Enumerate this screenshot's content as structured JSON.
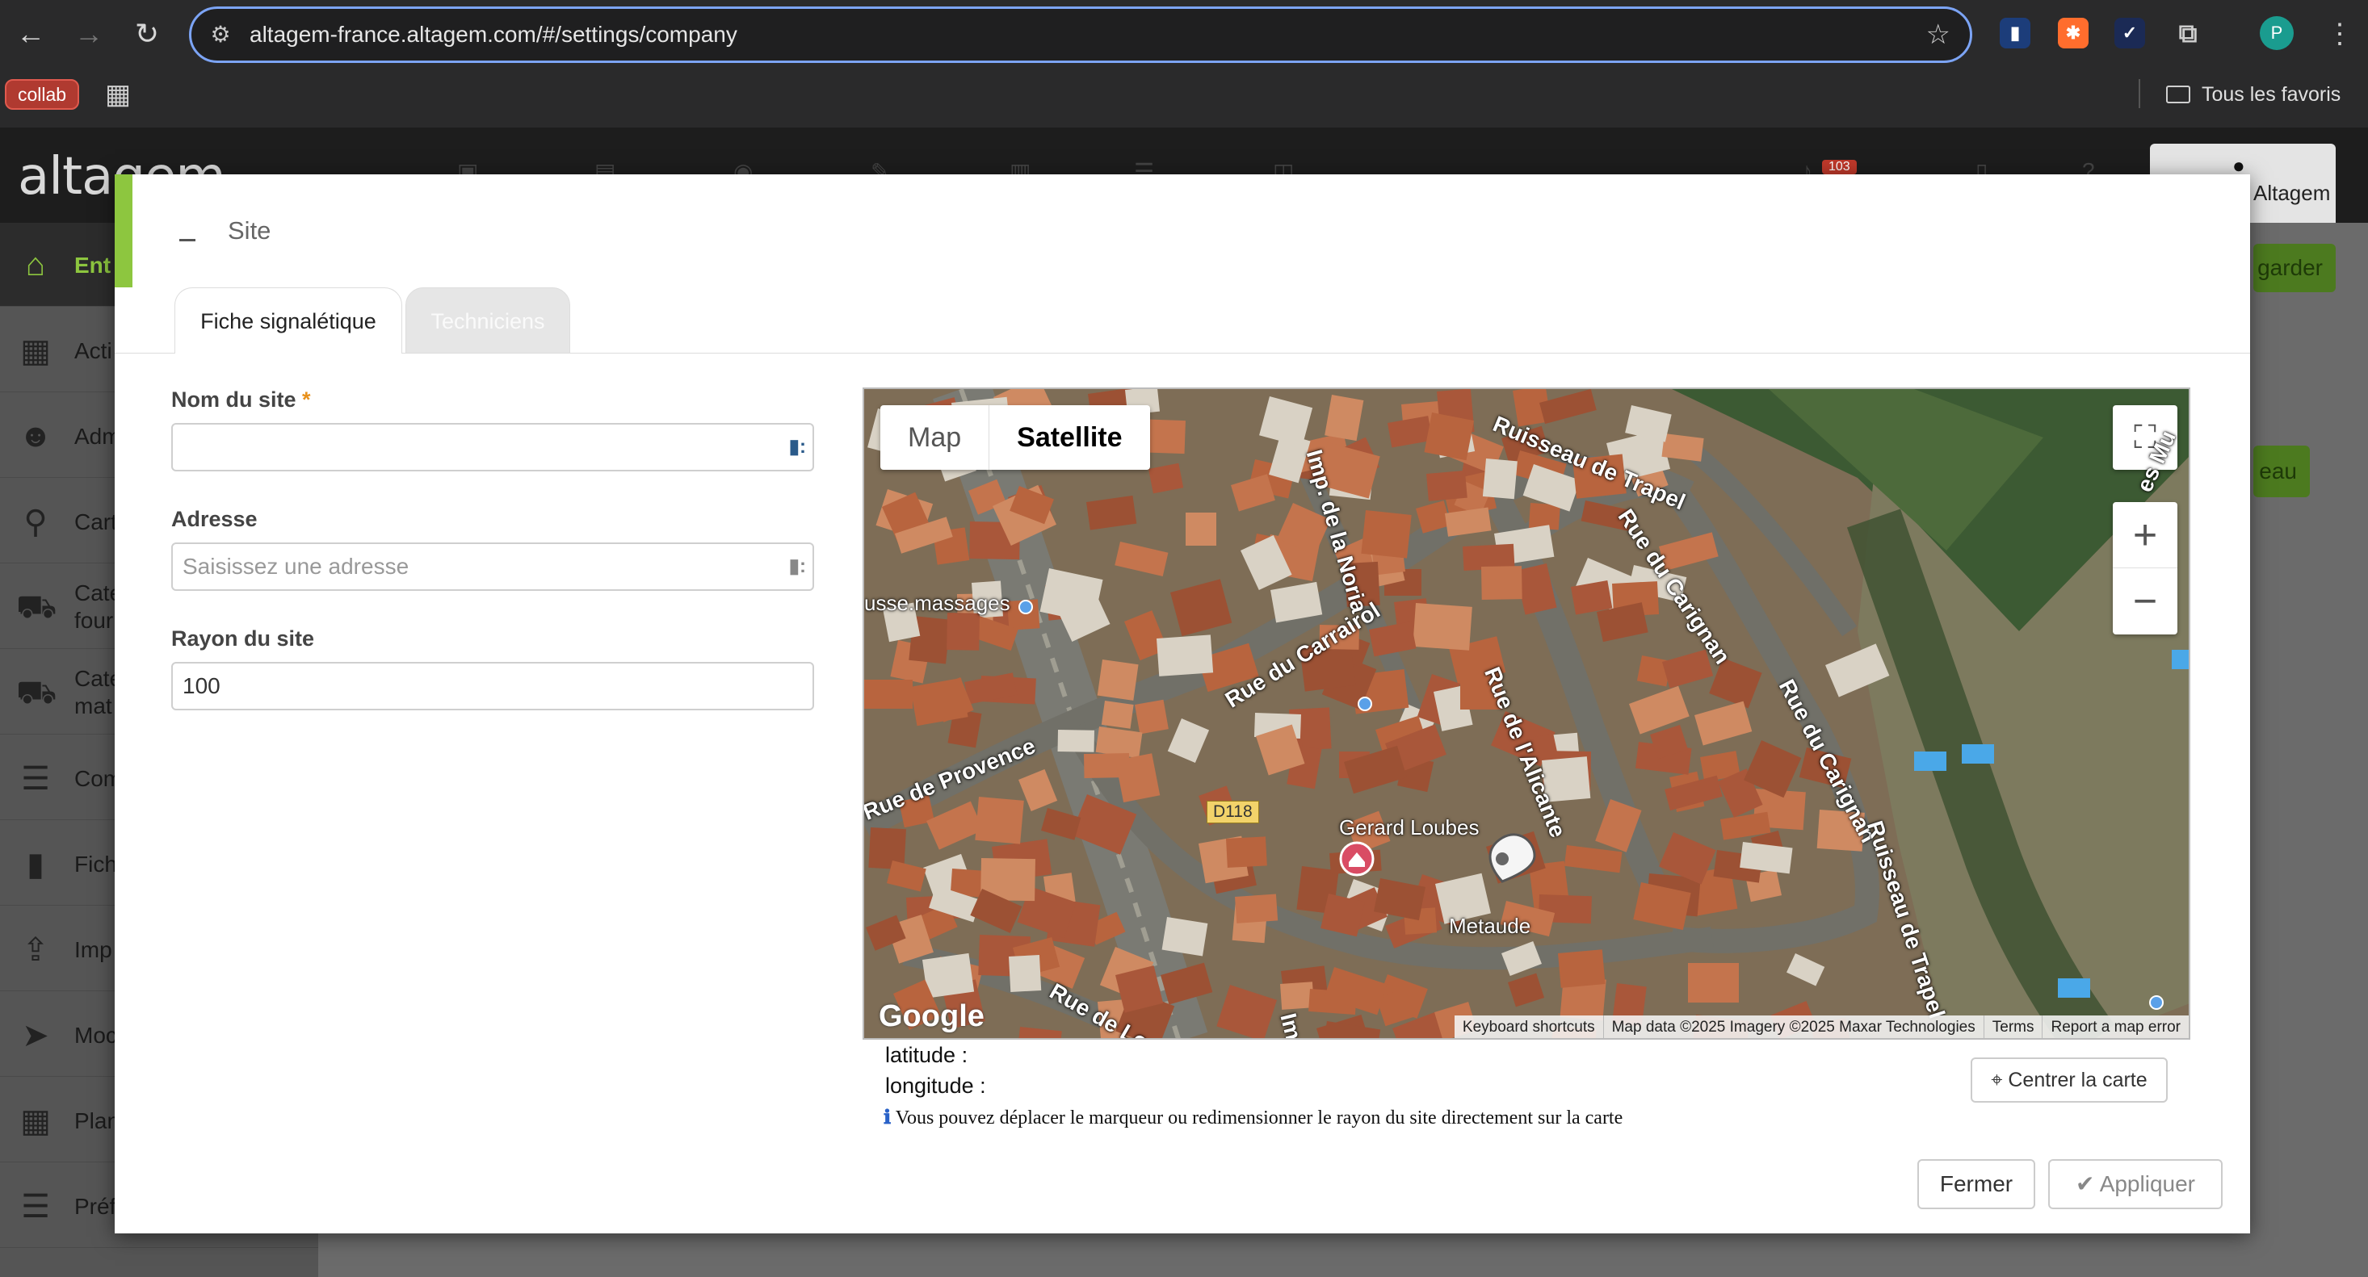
{
  "browser": {
    "url": "altagem-france.altagem.com/#/settings/company",
    "bookmark_collab": "collab",
    "bookmarks_all": "Tous les favoris",
    "profile_initial": "P"
  },
  "app": {
    "logo": "altagem",
    "notification_count": "103",
    "user_name": "Altagem",
    "save_label": "garder",
    "new_label": "eau",
    "sidebar": [
      {
        "label": "Ent",
        "icon": "home-icon"
      },
      {
        "label": "Acti",
        "icon": "dashboard-icon"
      },
      {
        "label": "Adm",
        "icon": "users-icon"
      },
      {
        "label": "Cart",
        "icon": "map-pin-icon"
      },
      {
        "label": "Caté\nfour",
        "icon": "cart-icon"
      },
      {
        "label": "Caté\nmat",
        "icon": "truck-icon"
      },
      {
        "label": "Com",
        "icon": "list-icon"
      },
      {
        "label": "Fich",
        "icon": "file-icon"
      },
      {
        "label": "Imp",
        "icon": "upload-icon"
      },
      {
        "label": "Moc",
        "icon": "send-icon"
      },
      {
        "label": "Plan",
        "icon": "calendar-icon"
      },
      {
        "label": "Préfiches",
        "icon": "server-icon"
      }
    ]
  },
  "modal": {
    "title": "Site",
    "tabs": [
      {
        "label": "Fiche signalétique",
        "active": true
      },
      {
        "label": "Techniciens",
        "active": false
      }
    ],
    "fields": {
      "site_name_label": "Nom du site",
      "site_name_required": "*",
      "site_name_value": "",
      "address_label": "Adresse",
      "address_placeholder": "Saisissez une adresse",
      "radius_label": "Rayon du site",
      "radius_value": "100"
    },
    "map": {
      "type_map": "Map",
      "type_satellite": "Satellite",
      "selected_type": "Satellite",
      "streets": [
        "Ruisseau de Trapel",
        "Imp. de la Noria",
        "Rue du Carrairol",
        "Rue de l'Alicante",
        "Rue du Carignan",
        "Rue du Carignan",
        "Ruisseau de Trapel",
        "Rue de Provence",
        "Rue de Lorra",
        "Imp.",
        "es Mu"
      ],
      "pois": [
        "usse.massages",
        "Gerard Loubes",
        "Metaude"
      ],
      "road_shield": "D118",
      "google": "Google",
      "attribution": [
        "Keyboard shortcuts",
        "Map data ©2025 Imagery ©2025 Maxar Technologies",
        "Terms",
        "Report a map error"
      ]
    },
    "latitude_label": "latitude :",
    "longitude_label": "longitude :",
    "center_button": "Centrer la carte",
    "hint_icon": "ℹ",
    "hint": "Vous pouvez déplacer le marqueur ou redimensionner le rayon du site directement sur la carte",
    "close_button": "Fermer",
    "apply_button": "Appliquer"
  }
}
